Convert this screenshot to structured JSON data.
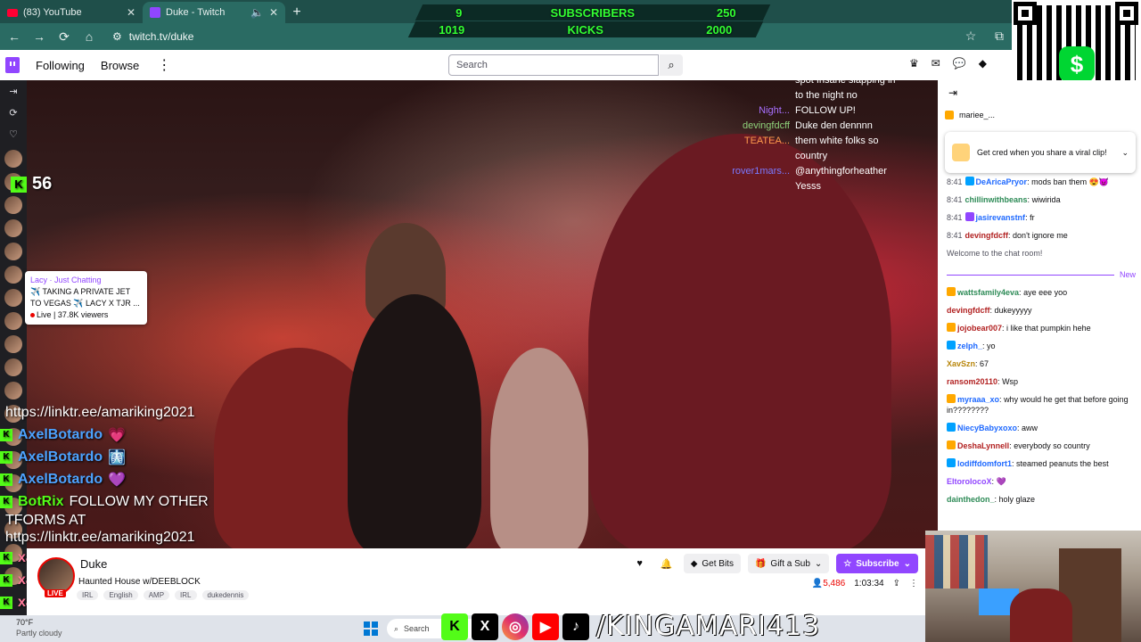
{
  "browser": {
    "tabs": [
      {
        "title": "(83) YouTube",
        "icon": "youtube-icon"
      },
      {
        "title": "Duke - Twitch",
        "icon": "twitch-icon"
      }
    ],
    "url": "twitch.tv/duke"
  },
  "topnav": {
    "following": "Following",
    "browse": "Browse",
    "search_placeholder": "Search"
  },
  "overlay": {
    "subs_row1": {
      "left": "9",
      "label": "SUBSCRIBERS",
      "right": "250"
    },
    "subs_row2": {
      "left": "1019",
      "label": "KICKS",
      "right": "2000"
    },
    "kick_count": "56",
    "cashapp_symbol": "$",
    "hover_card": {
      "name": "Lacy · Just Chatting",
      "title": "✈️ TAKING A PRIVATE JET TO VEGAS ✈️ LACY X TJR ...",
      "live": "Live",
      "viewers": "37.8K viewers"
    },
    "kick_chat": [
      {
        "name": "",
        "msg": "https://linktr.ee/amariking2021",
        "badge": false,
        "color": ""
      },
      {
        "name": "AxelBotardo",
        "msg": "💗",
        "badge": true,
        "color": "blue"
      },
      {
        "name": "AxelBotardo",
        "msg": "🩻",
        "badge": true,
        "color": "blue"
      },
      {
        "name": "AxelBotardo",
        "msg": "💜",
        "badge": true,
        "color": "blue"
      },
      {
        "name": "BotRix",
        "msg": "FOLLOW MY OTHER",
        "badge": true,
        "color": "green"
      },
      {
        "name": "",
        "msg": "TFORMS AT",
        "badge": false,
        "color": ""
      },
      {
        "name": "",
        "msg": "https://linktr.ee/amariking2021",
        "badge": false,
        "color": ""
      },
      {
        "name": "xaoandresito",
        "msg": "",
        "badge": true,
        "color": "pink"
      },
      {
        "name": "xaoandresito",
        "msg": "",
        "badge": true,
        "color": "pink"
      },
      {
        "name": "xaoandresito",
        "msg": "",
        "badge": true,
        "color": "pink"
      }
    ],
    "twitch_overlay_chat": [
      {
        "name": "",
        "msg": "spot Insane slapping in",
        "color": "#ffffff"
      },
      {
        "name": "",
        "msg": "to the night no",
        "color": "#ffffff"
      },
      {
        "name": "Night...",
        "msg": "FOLLOW UP!",
        "color": "#a970ff"
      },
      {
        "name": "devingfdcff",
        "msg": "Duke den dennnn",
        "color": "#8fd17a"
      },
      {
        "name": "TEATEA...",
        "msg": "them white folks so",
        "color": "#ff9a4d"
      },
      {
        "name": "",
        "msg": "country",
        "color": "#ffffff"
      },
      {
        "name": "rover1mars...",
        "msg": "@anythingforheather",
        "color": "#7a7aff"
      },
      {
        "name": "",
        "msg": "Yesss",
        "color": "#ffffff"
      }
    ],
    "social_handle": "/KINGAMARI413"
  },
  "channel": {
    "name": "Duke",
    "live_badge": "LIVE",
    "title": "Haunted House w/DEEBLOCK",
    "tags": [
      "IRL",
      "English",
      "AMP",
      "IRL",
      "dukedennis"
    ],
    "get_bits": "Get Bits",
    "gift_sub": "Gift a Sub",
    "subscribe": "Subscribe",
    "viewers": "5,486",
    "uptime": "1:03:34"
  },
  "chat": {
    "pinned_user": "mariee_...",
    "cred_text": "Get cred when you share a viral clip!",
    "messages_top": [
      {
        "time": "8:41",
        "user": "DeAricaPryor",
        "msg": "mods ban them 😍😈",
        "color": "#1e69ff"
      },
      {
        "time": "8:41",
        "user": "chillinwithbeans",
        "msg": "wiwirida",
        "color": "#2e8b57"
      },
      {
        "time": "8:41",
        "user": "jasirevanstnf",
        "msg": "fr",
        "color": "#1e69ff"
      },
      {
        "time": "8:41",
        "user": "devingfdcff",
        "msg": "don't ignore me",
        "color": "#b22222"
      }
    ],
    "welcome": "Welcome to the chat room!",
    "new_label": "New",
    "messages": [
      {
        "user": "wattsfamily4eva",
        "msg": "aye eee yoo",
        "color": "#2e8b57"
      },
      {
        "user": "devingfdcff",
        "msg": "dukeyyyyy",
        "color": "#b22222"
      },
      {
        "user": "jojobear007",
        "msg": "i like that pumpkin hehe",
        "color": "#b22222"
      },
      {
        "user": "zelph_",
        "msg": "yo",
        "color": "#1e69ff"
      },
      {
        "user": "XavSzn",
        "msg": "67",
        "color": "#b8860b"
      },
      {
        "user": "ransom20110",
        "msg": "Wsp",
        "color": "#b22222"
      },
      {
        "user": "myraaa_xo",
        "msg": "why would he get that before going in????????",
        "color": "#1e69ff"
      },
      {
        "user": "NiecyBabyxoxo",
        "msg": "aww",
        "color": "#1e69ff"
      },
      {
        "user": "DeshaLynnell",
        "msg": "everybody so country",
        "color": "#b22222"
      },
      {
        "user": "lodiffdomfort1",
        "msg": "steamed peanuts the best",
        "color": "#1e69ff"
      },
      {
        "user": "EltoroIocoX",
        "msg": "💜",
        "color": "#9146ff"
      },
      {
        "user": "dainthedon_",
        "msg": "holy glaze",
        "color": "#2e8b57"
      }
    ]
  },
  "taskbar": {
    "weather_temp": "70°F",
    "weather_desc": "Partly cloudy",
    "search": "Search"
  },
  "colors": {
    "twitch_purple": "#9146ff",
    "kick_green": "#53fc18",
    "live_red": "#eb0400"
  }
}
